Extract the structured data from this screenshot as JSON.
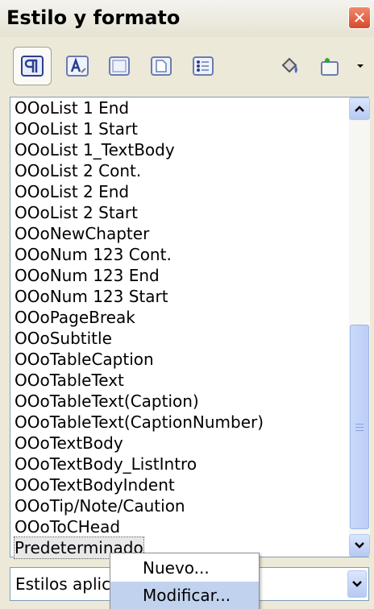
{
  "window": {
    "title": "Estilo y formato",
    "close_glyph": "✕"
  },
  "toolbar": {
    "buttons": [
      {
        "icon": "paragraph-styles-icon",
        "active": true
      },
      {
        "icon": "character-styles-icon"
      },
      {
        "icon": "frame-styles-icon"
      },
      {
        "icon": "page-styles-icon"
      },
      {
        "icon": "list-styles-icon"
      },
      {
        "icon": "fill-format-mode-icon"
      },
      {
        "icon": "new-style-from-selection-icon"
      },
      {
        "icon": "chevron-down-icon"
      }
    ]
  },
  "style_list": {
    "items": [
      "OOoList 1 End",
      "OOoList 1 Start",
      "OOoList 1_TextBody",
      "OOoList 2 Cont.",
      "OOoList 2 End",
      "OOoList 2 Start",
      "OOoNewChapter",
      "OOoNum 123 Cont.",
      "OOoNum 123 End",
      "OOoNum 123 Start",
      "OOoPageBreak",
      "OOoSubtitle",
      "OOoTableCaption",
      "OOoTableText",
      "OOoTableText(Caption)",
      "OOoTableText(CaptionNumber)",
      "OOoTextBody",
      "OOoTextBody_ListIntro",
      "OOoTextBodyIndent",
      "OOoTip/Note/Caution",
      "OOoToCHead",
      "Predeterminado"
    ],
    "selected_index": 21
  },
  "filter": {
    "value": "Estilos aplic"
  },
  "context_menu": {
    "items": [
      {
        "label": "Nuevo...",
        "mnemonic": "N"
      },
      {
        "label": "Modificar...",
        "mnemonic": "M",
        "highlighted": true
      }
    ]
  },
  "colors": {
    "accent": "#c1d2ee",
    "close": "#d8492c",
    "scroll": "#b5c9f3"
  }
}
